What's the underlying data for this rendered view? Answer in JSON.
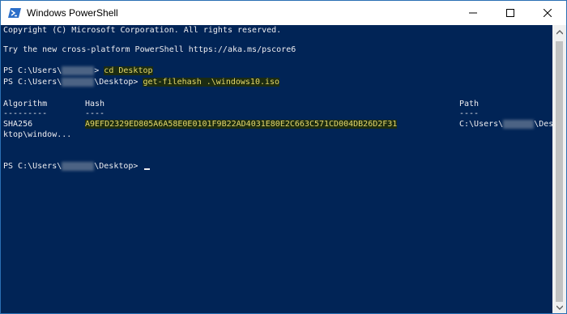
{
  "window": {
    "title": "Windows PowerShell",
    "icon": "powershell-icon"
  },
  "controls": {
    "minimize": "minimize-icon",
    "maximize": "maximize-icon",
    "close": "close-icon"
  },
  "console": {
    "copyright": "Copyright (C) Microsoft Corporation. All rights reserved.",
    "hint": "Try the new cross-platform PowerShell https://aka.ms/pscore6",
    "prompt_prefix": "PS C:\\Users\\",
    "prompt_suffix_home": "> ",
    "prompt_desktop_suffix": "\\Desktop> ",
    "cmd1": "cd Desktop",
    "cmd2": "get-filehash .\\windows10.iso",
    "headers": {
      "algorithm": "Algorithm",
      "hash": "Hash",
      "path": "Path"
    },
    "underlines": {
      "algorithm": "---------",
      "hash": "----",
      "path": "----"
    },
    "row": {
      "algorithm": "SHA256",
      "hash": "A9EFD2329ED805A6A58E0E0101F9B22AD4031E80E2C663C571CD004DB26D2F31",
      "path_prefix": "C:\\Users\\",
      "path_suffix": "\\Des",
      "path_wrap": "ktop\\window..."
    }
  },
  "colors": {
    "console_bg": "#012456",
    "console_fg": "#eeedf0",
    "highlight_fg": "#e5d86a",
    "highlight_bg": "#1c2c12"
  }
}
